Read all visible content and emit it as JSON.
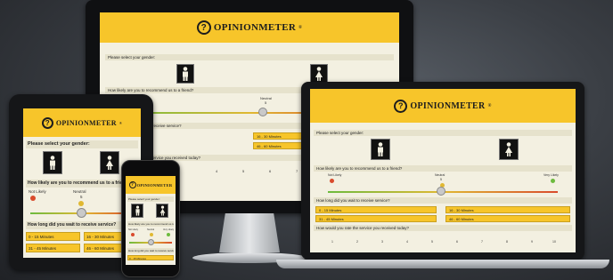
{
  "brand": {
    "name": "OPINIONMETER",
    "mark": "?",
    "reg": "®"
  },
  "colors": {
    "accent": "#f7c52a",
    "screen_bg": "#f3f0e1",
    "bezel": "#151618",
    "backdrop": "#3b3f45"
  },
  "questions": {
    "gender": "Please select your gender:",
    "recommend": "How likely are you to recommend us to a friend?",
    "wait": "How long did you wait to receive service?",
    "satisfaction": "How would you rate the service you received today?"
  },
  "scale": {
    "not_likely": "Not Likely",
    "neutral": "Neutral",
    "very_likely": "Very Likely",
    "neutral_value": "5",
    "slider_level_percent": 55
  },
  "wait_options": [
    "0 - 15 Minutes",
    "16 - 30 Minutes",
    "31 - 45 Minutes",
    "46 - 60 Minutes"
  ],
  "rating_scale": [
    "1",
    "2",
    "3",
    "4",
    "5",
    "6",
    "7",
    "8",
    "9",
    "10"
  ],
  "icons": {
    "male": "male-figure-icon",
    "female": "female-figure-icon"
  }
}
